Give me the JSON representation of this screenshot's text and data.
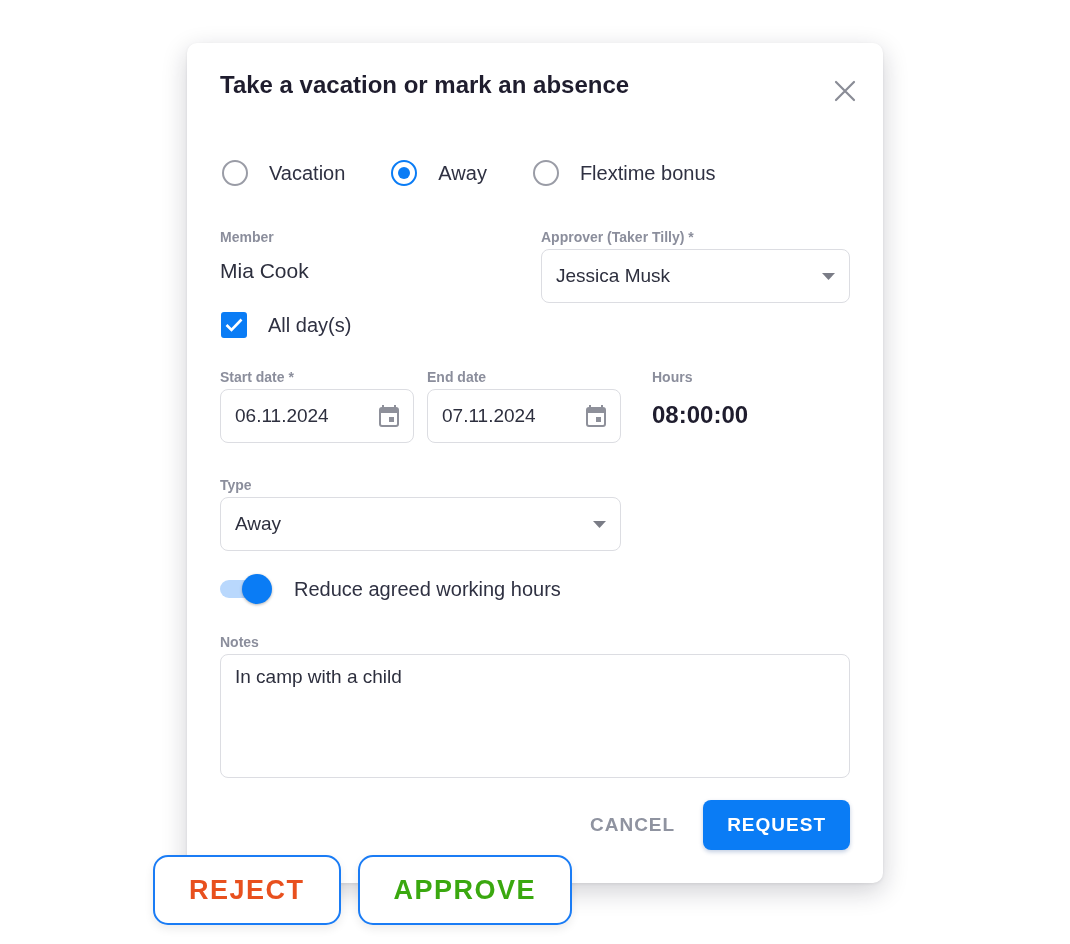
{
  "dialog": {
    "title": "Take a vacation or mark an absence",
    "absence_types": [
      {
        "label": "Vacation",
        "selected": false
      },
      {
        "label": "Away",
        "selected": true
      },
      {
        "label": "Flextime bonus",
        "selected": false
      }
    ],
    "member": {
      "label": "Member",
      "value": "Mia Cook"
    },
    "approver": {
      "label": "Approver (Taker Tilly) *",
      "value": "Jessica Musk"
    },
    "all_days": {
      "label": "All day(s)",
      "checked": true
    },
    "dates": [
      {
        "label": "Start date *",
        "value": "06.11.2024"
      },
      {
        "label": "End date",
        "value": "07.11.2024"
      }
    ],
    "hours": {
      "label": "Hours",
      "value": "08:00:00"
    },
    "type": {
      "label": "Type",
      "value": "Away"
    },
    "reduce_hours": {
      "label": "Reduce agreed working hours",
      "on": true
    },
    "notes": {
      "label": "Notes",
      "value": "In camp with a child"
    },
    "buttons": [
      {
        "label": "CANCEL",
        "kind": "text"
      },
      {
        "label": "REQUEST",
        "kind": "primary"
      }
    ]
  },
  "review_actions": [
    {
      "label": "REJECT",
      "color": "#e8501e"
    },
    {
      "label": "APPROVE",
      "color": "#3aa80f"
    }
  ]
}
